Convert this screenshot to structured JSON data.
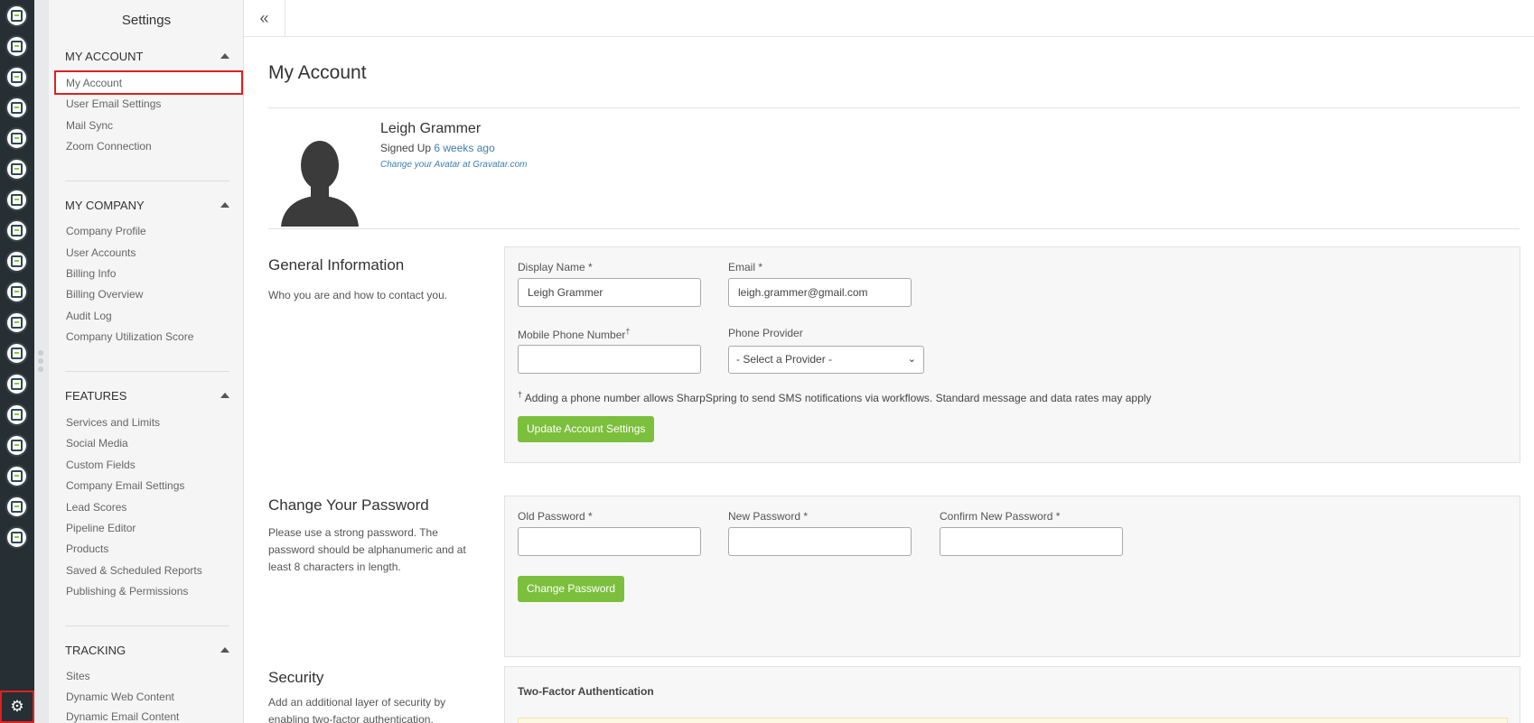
{
  "rail": {
    "icons": [
      "contacts-icon",
      "email-icon",
      "clipboard-icon",
      "map-icon",
      "branch-icon",
      "list-icon",
      "megaphone-icon",
      "chat-icon",
      "thumbs-up-icon",
      "tv-icon",
      "image-icon",
      "calendar-icon",
      "handshake-icon",
      "trend-chart-icon",
      "headset-icon",
      "add-user-icon",
      "bar-chart-icon",
      "plug-icon"
    ],
    "gear": "⚙"
  },
  "sidebar": {
    "title": "Settings",
    "sections": [
      {
        "title": "MY ACCOUNT",
        "items": [
          "My Account",
          "User Email Settings",
          "Mail Sync",
          "Zoom Connection"
        ]
      },
      {
        "title": "MY COMPANY",
        "items": [
          "Company Profile",
          "User Accounts",
          "Billing Info",
          "Billing Overview",
          "Audit Log",
          "Company Utilization Score"
        ]
      },
      {
        "title": "FEATURES",
        "items": [
          "Services and Limits",
          "Social Media",
          "Custom Fields",
          "Company Email Settings",
          "Lead Scores",
          "Pipeline Editor",
          "Products",
          "Saved & Scheduled Reports",
          "Publishing & Permissions"
        ]
      },
      {
        "title": "TRACKING",
        "items": [
          "Sites",
          "Dynamic Web Content",
          "Dynamic Email Content"
        ]
      }
    ]
  },
  "topbar": {
    "collapse_glyph": "«"
  },
  "page": {
    "title": "My Account",
    "profile": {
      "name": "Leigh Grammer",
      "signed_prefix": "Signed Up ",
      "signed_time": "6 weeks ago",
      "gravatar_link": "Change your Avatar at Gravatar.com"
    },
    "general": {
      "title": "General Information",
      "desc": "Who you are and how to contact you.",
      "display_name_label": "Display Name *",
      "display_name_value": "Leigh Grammer",
      "email_label": "Email *",
      "email_value": "leigh.grammer@gmail.com",
      "mobile_label": "Mobile Phone Number",
      "mobile_mark": "†",
      "mobile_value": "",
      "provider_label": "Phone Provider",
      "provider_value": "- Select a Provider -",
      "note_mark": "†",
      "note": " Adding a phone number allows SharpSpring to send SMS notifications via workflows. Standard message and data rates may apply",
      "update_button": "Update Account Settings"
    },
    "password": {
      "title": "Change Your Password",
      "desc": "Please use a strong password. The password should be alphanumeric and at least 8 characters in length.",
      "old_label": "Old Password *",
      "new_label": "New Password *",
      "confirm_label": "Confirm New Password *",
      "button": "Change Password"
    },
    "security": {
      "title": "Security",
      "desc": "Add an additional layer of security by enabling two-factor authentication.",
      "two_factor_title": "Two-Factor Authentication"
    }
  },
  "colors": {
    "accent_green": "#7cbf3d",
    "rail_bg": "#262f34",
    "highlight_red": "#e02020",
    "link_blue": "#3d7fb0"
  }
}
